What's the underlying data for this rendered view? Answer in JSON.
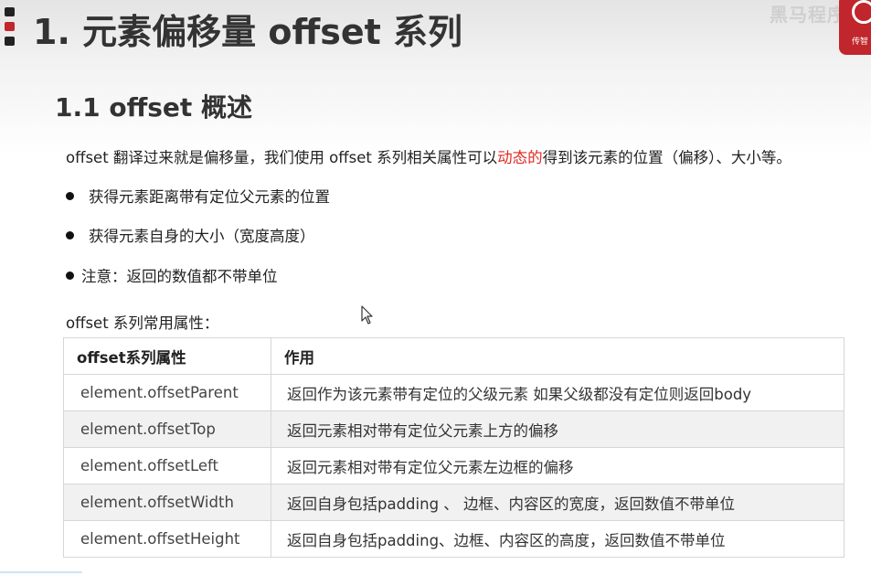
{
  "header": {
    "top_cut_text": "…-  …  -  -  ­",
    "title": "1. 元素偏移量 offset 系列",
    "brand_text": "黑马程序",
    "brand_sub": "传智"
  },
  "section": {
    "title": "1.1 offset 概述"
  },
  "intro": {
    "before": "offset 翻译过来就是偏移量，我们使用 offset 系列相关属性可以",
    "highlight": "动态的",
    "after": "得到该元素的位置（偏移）、大小等。"
  },
  "bullets": [
    "获得元素距离带有定位父元素的位置",
    "获得元素自身的大小（宽度高度）",
    "注意：返回的数值都不带单位"
  ],
  "table_caption": "offset 系列常用属性：",
  "table": {
    "headers": [
      "offset系列属性",
      "作用"
    ],
    "rows": [
      [
        "element.offsetParent",
        "返回作为该元素带有定位的父级元素 如果父级都没有定位则返回body"
      ],
      [
        "element.offsetTop",
        "返回元素相对带有定位父元素上方的偏移"
      ],
      [
        "element.offsetLeft",
        "返回元素相对带有定位父元素左边框的偏移"
      ],
      [
        "element.offsetWidth",
        "返回自身包括padding 、 边框、内容区的宽度，返回数值不带单位"
      ],
      [
        "element.offsetHeight",
        "返回自身包括padding、边框、内容区的高度，返回数值不带单位"
      ]
    ]
  },
  "colors": {
    "highlight": "#e0291f",
    "brand_red": "#c0262b"
  },
  "icons": {
    "cursor": "mouse-pointer-icon",
    "logo": "brand-logo-icon"
  }
}
